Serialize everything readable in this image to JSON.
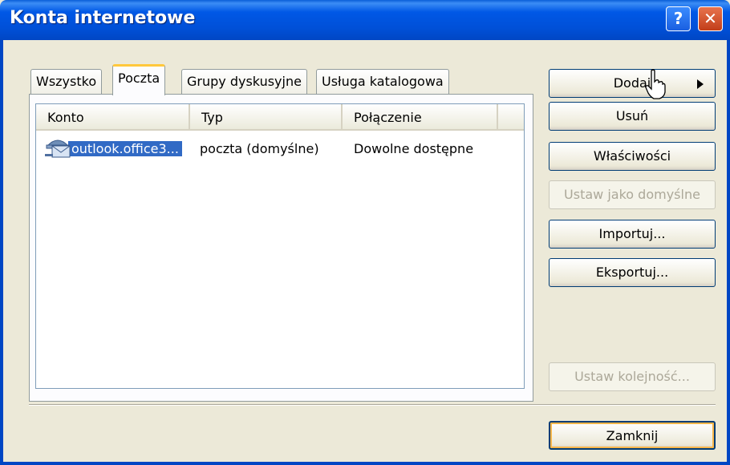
{
  "window": {
    "title": "Konta internetowe",
    "help_glyph": "?",
    "close_glyph": "✕"
  },
  "tabs": [
    {
      "label": "Wszystko",
      "active": false
    },
    {
      "label": "Poczta",
      "active": true
    },
    {
      "label": "Grupy dyskusyjne",
      "active": false
    },
    {
      "label": "Usługa katalogowa",
      "active": false
    }
  ],
  "list": {
    "columns": [
      "Konto",
      "Typ",
      "Połączenie"
    ],
    "rows": [
      {
        "konto": "outlook.office3...",
        "typ": "poczta (domyślne)",
        "polaczenie": "Dowolne dostępne",
        "icon": "mail-account-icon",
        "selected": true
      }
    ]
  },
  "buttons": {
    "add": "Dodaj",
    "remove": "Usuń",
    "properties": "Właściwości",
    "set_default": "Ustaw jako domyślne",
    "import": "Importuj...",
    "export": "Eksportuj...",
    "set_order": "Ustaw kolejność...",
    "close": "Zamknij"
  },
  "colors": {
    "titlebar": "#0058e6",
    "selection": "#316ac5",
    "dialog_bg": "#ece9d8"
  }
}
